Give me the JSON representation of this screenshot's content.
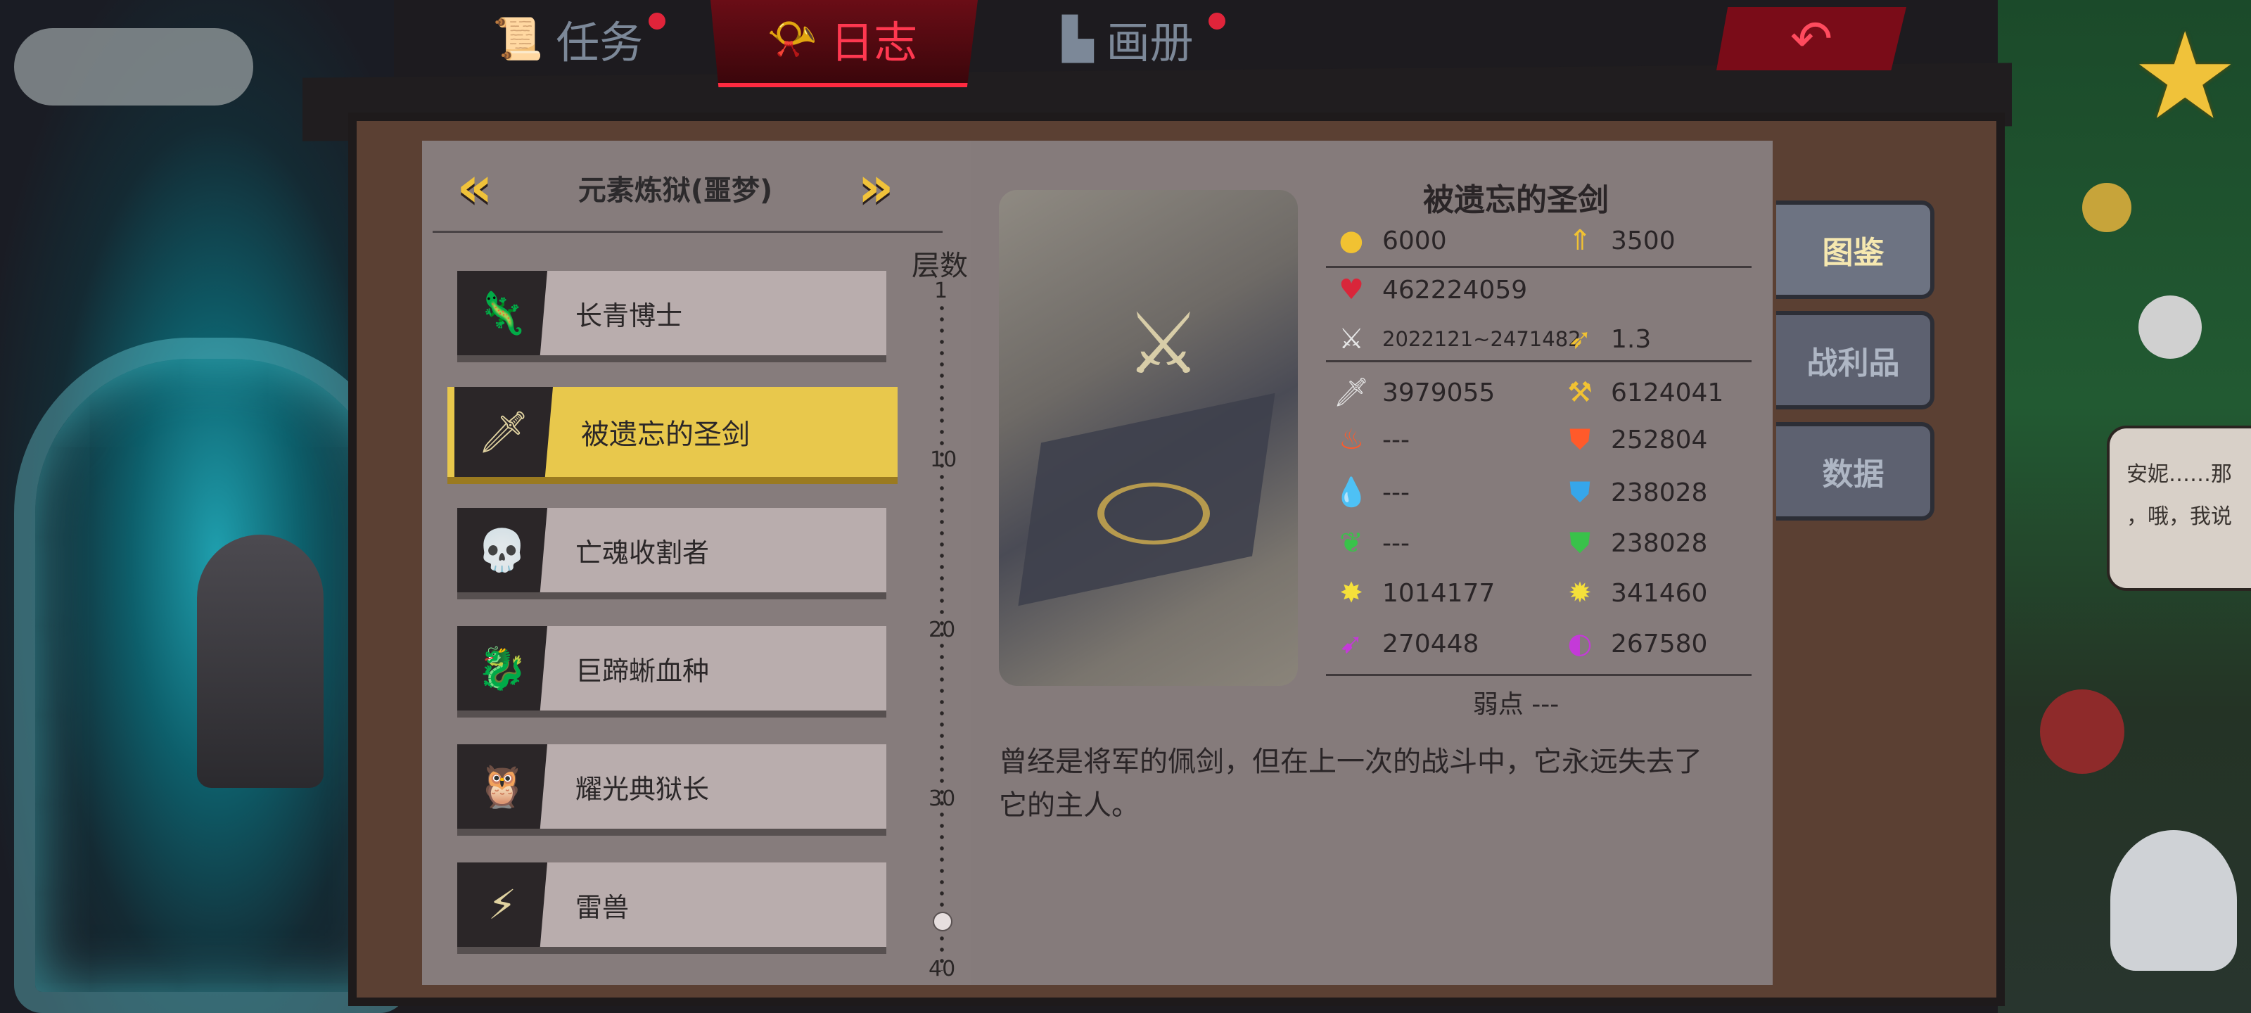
{
  "top_tabs": [
    {
      "label": "任务",
      "icon": "scroll-icon",
      "has_badge": true
    },
    {
      "label": "日志",
      "icon": "horn-icon",
      "has_badge": false,
      "active": true
    },
    {
      "label": "画册",
      "icon": "album-icon",
      "has_badge": true
    }
  ],
  "back_button_icon": "back-arrow-icon",
  "area": {
    "title": "元素炼狱(噩梦)",
    "prev_icon": "double-chevron-left-icon",
    "next_icon": "double-chevron-right-icon"
  },
  "bosses": [
    {
      "name": "长青博士"
    },
    {
      "name": "被遗忘的圣剑",
      "selected": true
    },
    {
      "name": "亡魂收割者"
    },
    {
      "name": "巨蹄蜥血种"
    },
    {
      "name": "耀光典狱长"
    },
    {
      "name": "雷兽"
    }
  ],
  "floor_scale": {
    "label": "层数",
    "ticks": [
      "1",
      "10",
      "20",
      "30",
      "40"
    ],
    "current_floor": 37
  },
  "detail": {
    "name": "被遗忘的圣剑",
    "gold": "6000",
    "exp": "3500",
    "hp": "462224059",
    "attack_range": "2022121~2471482",
    "attack_speed": "1.3",
    "physical_attack": "3979055",
    "physical_defense": "6124041",
    "fire_attack": "---",
    "fire_resist": "252804",
    "water_attack": "---",
    "water_resist": "238028",
    "wind_attack": "---",
    "wind_resist": "238028",
    "light_attack": "1014177",
    "light_resist": "341460",
    "dark_attack": "270448",
    "dark_resist": "267580",
    "weakness": "弱点 ---",
    "description_line1": "曾经是将军的佩剑，但在上一次的战斗中，它永远失去了",
    "description_line2": "它的主人。"
  },
  "side_tabs": [
    {
      "label": "图鉴",
      "active": true
    },
    {
      "label": "战利品"
    },
    {
      "label": "数据"
    }
  ],
  "npc_bubble": {
    "line1": "安妮……那",
    "line2": "，哦，我说"
  },
  "colors": {
    "accent_gold": "#e8c84c",
    "tab_active_red": "#ff3850",
    "paper": "#857b7b"
  }
}
